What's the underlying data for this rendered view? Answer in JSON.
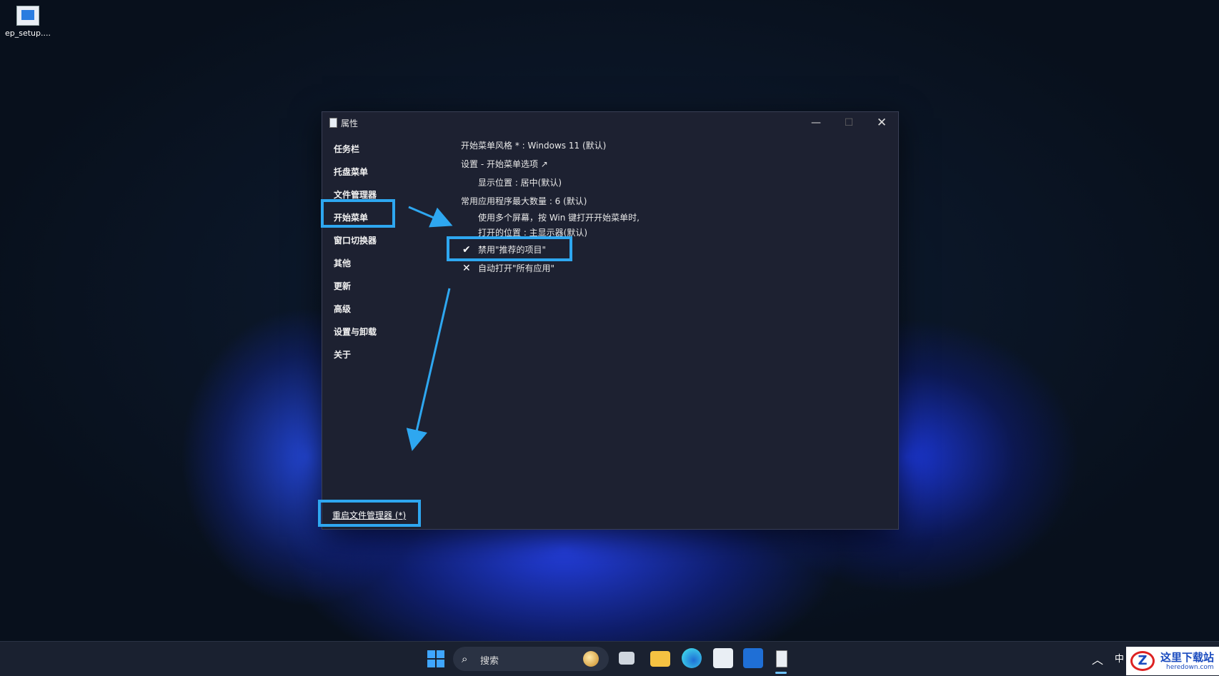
{
  "desktop": {
    "icon_label": "ep_setup...."
  },
  "window": {
    "title": "属性",
    "nav": [
      "任务栏",
      "托盘菜单",
      "文件管理器",
      "开始菜单",
      "窗口切换器",
      "其他",
      "更新",
      "高级",
      "设置与卸载",
      "关于"
    ],
    "content": {
      "style": "开始菜单风格 * : Windows 11 (默认)",
      "settings_link": "设置 - 开始菜单选项 ↗",
      "position": "显示位置 : 居中(默认)",
      "max_apps": "常用应用程序最大数量 : 6 (默认)",
      "multi_screen_1": "使用多个屏幕，按 Win 键打开开始菜单时,",
      "multi_screen_2": "打开的位置 : 主显示器(默认)",
      "disable_recommended": "禁用\"推荐的项目\"",
      "auto_open_all": "自动打开\"所有应用\"",
      "check_mark": "✔",
      "x_mark": "✕"
    },
    "restart_link": "重启文件管理器 (*)"
  },
  "taskbar": {
    "search_placeholder": "搜索",
    "search_icon": "⌕",
    "tray_up": "︿",
    "ime": "中"
  },
  "watermark": {
    "logo": "Z",
    "name": "这里下载站",
    "url": "heredown.com"
  },
  "colors": {
    "highlight": "#2ea7f0",
    "window_bg": "#1d2131",
    "accent": "#3fa6ff"
  }
}
